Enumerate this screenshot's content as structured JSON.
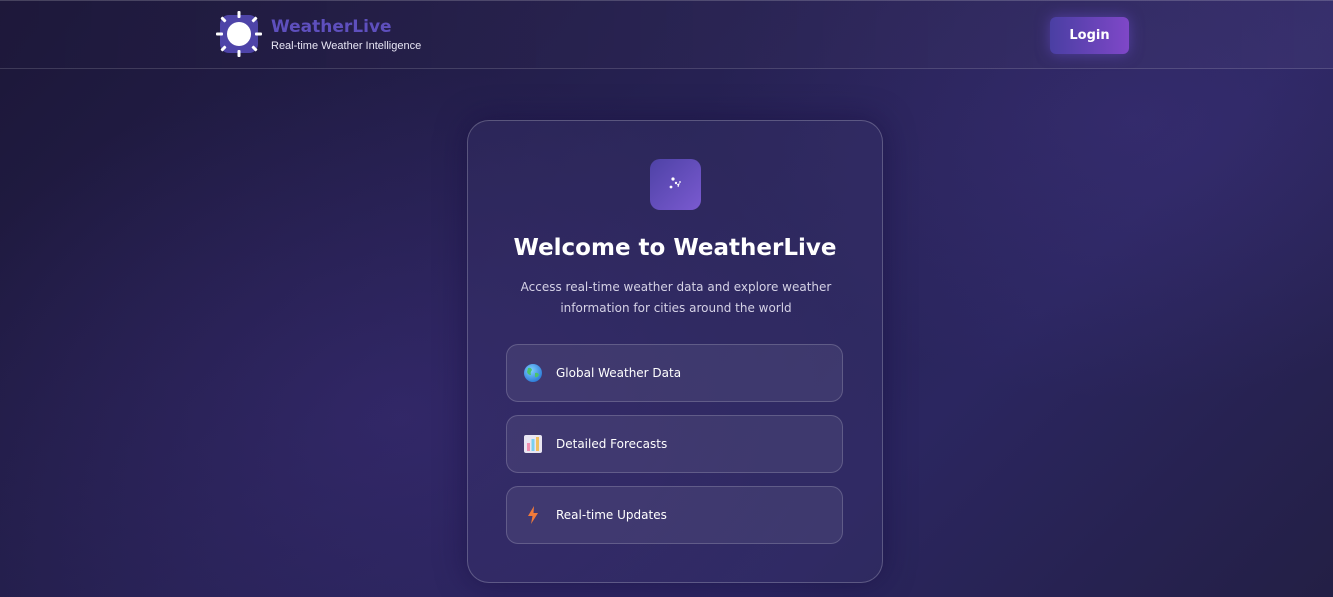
{
  "header": {
    "brand_title": "WeatherLive",
    "brand_tagline": "Real-time Weather Intelligence",
    "login_label": "Login",
    "logo_icon": "sun-icon"
  },
  "card": {
    "icon": "weather-app-icon",
    "title": "Welcome to WeatherLive",
    "subtitle": "Access real-time weather data and explore weather information for cities around the world",
    "features": [
      {
        "icon": "globe-icon",
        "label": "Global Weather Data"
      },
      {
        "icon": "bar-chart-icon",
        "label": "Detailed Forecasts"
      },
      {
        "icon": "lightning-icon",
        "label": "Real-time Updates"
      }
    ]
  },
  "colors": {
    "brand": "#5e4fbd",
    "accent_start": "#4a3fa3",
    "accent_end": "#7f47c8"
  }
}
